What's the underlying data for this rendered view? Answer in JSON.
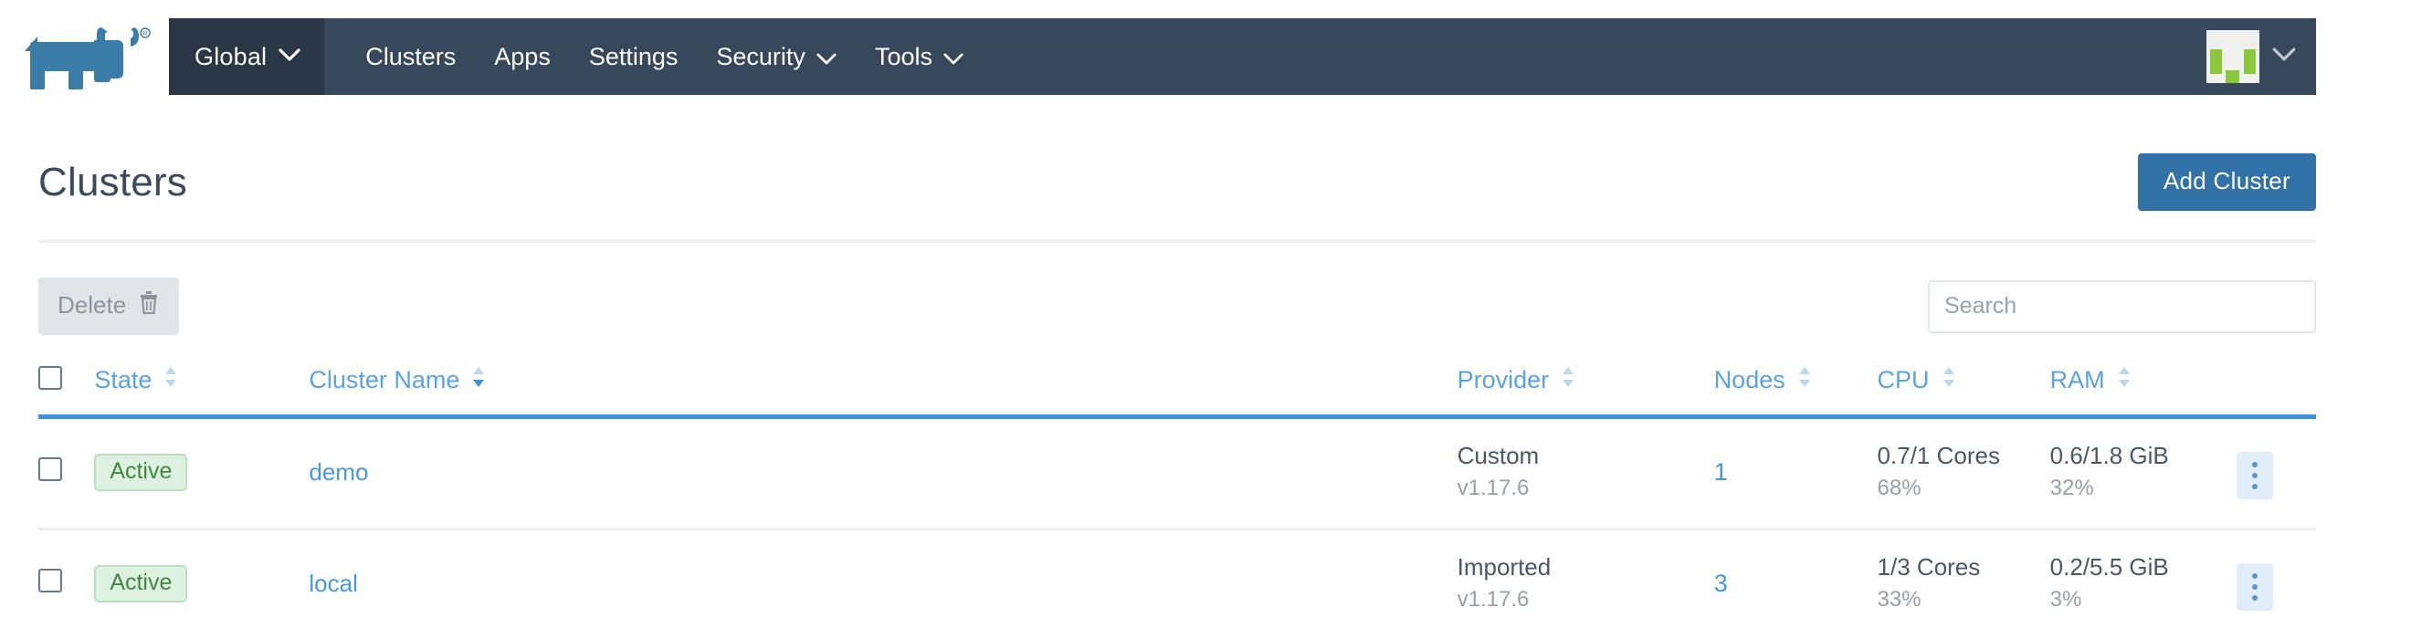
{
  "header": {
    "logo_name": "rancher-cow-logo",
    "context_selector": {
      "label": "Global",
      "caret": "chevron-down-icon"
    },
    "nav_links": [
      {
        "label": "Clusters",
        "has_caret": false
      },
      {
        "label": "Apps",
        "has_caret": false
      },
      {
        "label": "Settings",
        "has_caret": false
      },
      {
        "label": "Security",
        "has_caret": true
      },
      {
        "label": "Tools",
        "has_caret": true
      }
    ],
    "user_menu": {
      "avatar_name": "user-avatar",
      "caret": "chevron-down-icon"
    }
  },
  "page": {
    "title": "Clusters",
    "add_cluster_label": "Add Cluster"
  },
  "toolbar": {
    "delete_label": "Delete",
    "delete_icon": "trash-icon",
    "search_placeholder": "Search",
    "search_value": ""
  },
  "table": {
    "columns": [
      {
        "key": "select",
        "label": "",
        "sortable": false
      },
      {
        "key": "state",
        "label": "State",
        "sortable": true
      },
      {
        "key": "name",
        "label": "Cluster Name",
        "sortable": true
      },
      {
        "key": "provider",
        "label": "Provider",
        "sortable": true
      },
      {
        "key": "nodes",
        "label": "Nodes",
        "sortable": true
      },
      {
        "key": "cpu",
        "label": "CPU",
        "sortable": true
      },
      {
        "key": "ram",
        "label": "RAM",
        "sortable": true
      },
      {
        "key": "actions",
        "label": "",
        "sortable": false
      }
    ],
    "rows": [
      {
        "selected": false,
        "state": "Active",
        "name": "demo",
        "provider": "Custom",
        "provider_version": "v1.17.6",
        "nodes": "1",
        "cpu": "0.7/1 Cores",
        "cpu_percent": "68%",
        "ram": "0.6/1.8 GiB",
        "ram_percent": "32%"
      },
      {
        "selected": false,
        "state": "Active",
        "name": "local",
        "provider": "Imported",
        "provider_version": "v1.17.6",
        "nodes": "3",
        "cpu": "1/3 Cores",
        "cpu_percent": "33%",
        "ram": "0.2/5.5 GiB",
        "ram_percent": "3%"
      }
    ]
  },
  "colors": {
    "navbar": "#37475c",
    "navbar_context": "#2b3747",
    "primary": "#3272a6",
    "link": "#4a98da",
    "header_underline": "#3d92d9",
    "active_badge_text": "#41883f",
    "active_badge_bg": "#dff2e1",
    "logo_blue": "#3b7ca8",
    "avatar_green": "#8cc63e"
  }
}
